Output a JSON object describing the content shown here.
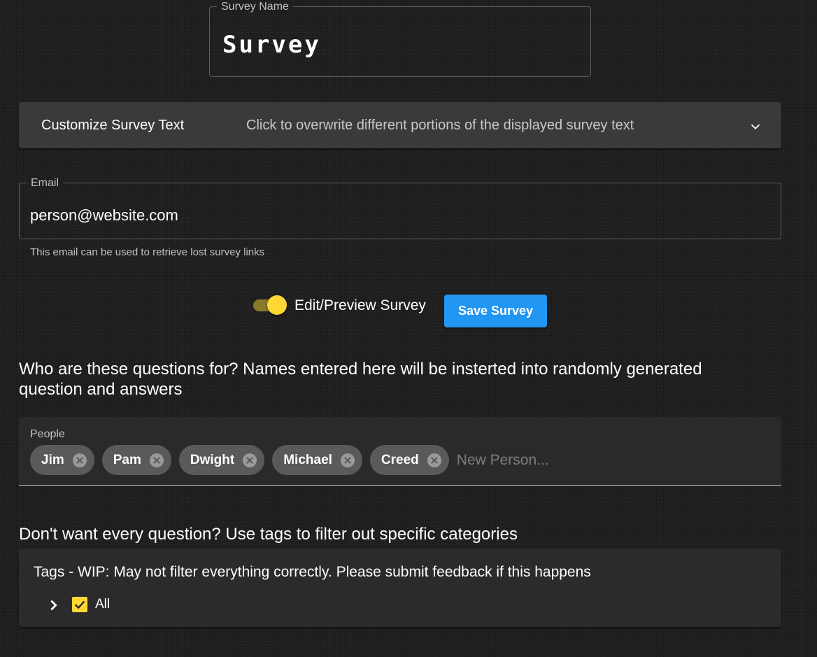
{
  "survey_name": {
    "label": "Survey Name",
    "value": "Survey"
  },
  "customize_text": {
    "title": "Customize Survey Text",
    "description": "Click to overwrite different portions of the displayed survey text",
    "icon": "chevron-down-icon"
  },
  "email": {
    "label": "Email",
    "value": "person@website.com",
    "helper": "This email can be used to retrieve lost survey links"
  },
  "edit_preview": {
    "label": "Edit/Preview Survey",
    "checked": true
  },
  "save_button": {
    "label": "Save Survey"
  },
  "people_section": {
    "heading": "Who are these questions for? Names entered here will be insterted into randomly generated question and answers",
    "label": "People",
    "chips": [
      "Jim",
      "Pam",
      "Dwight",
      "Michael",
      "Creed"
    ],
    "placeholder": "New Person..."
  },
  "tags_section": {
    "heading": "Don't want every question? Use tags to filter out specific categories",
    "title": "Tags - WIP: May not filter everything correctly. Please submit feedback if this happens",
    "tree_root_label": "All",
    "tree_root_checked": true
  },
  "colors": {
    "accent_yellow": "#fdd835",
    "button_blue": "#2196f3",
    "background": "#1e1e1e"
  }
}
